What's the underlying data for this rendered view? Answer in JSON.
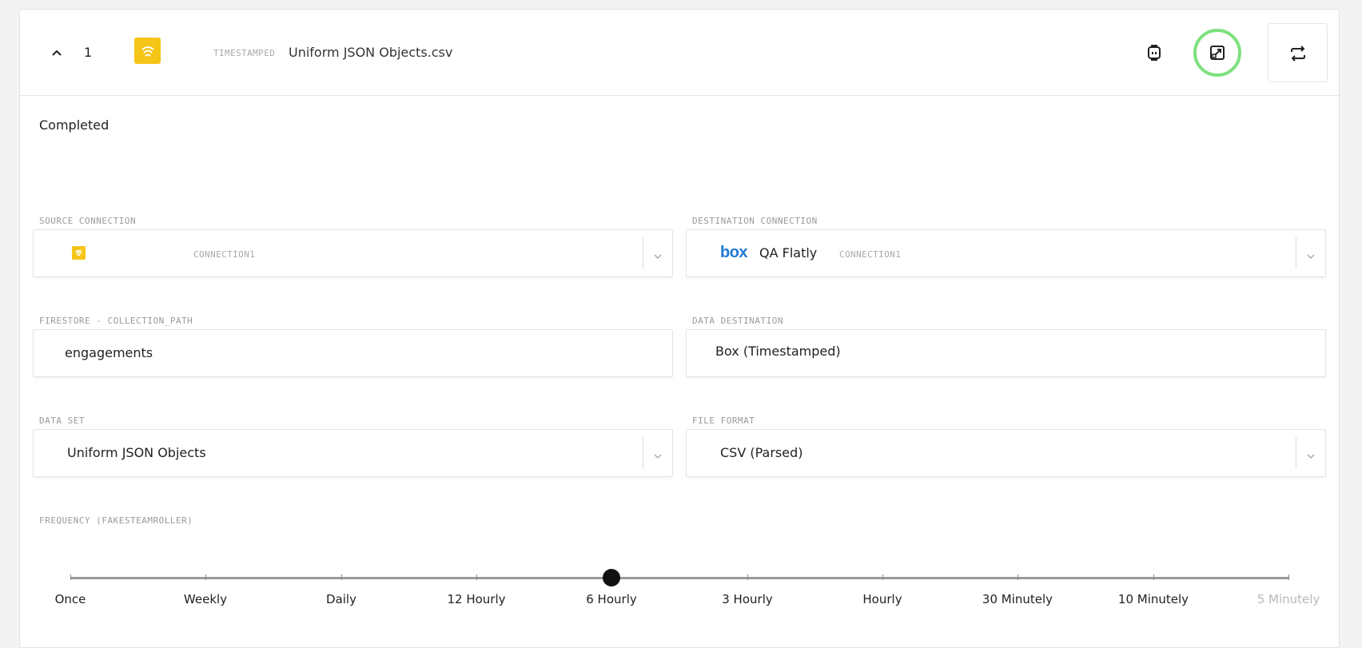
{
  "header": {
    "row_number": "1",
    "tag": "TIMESTAMPED",
    "file_name": "Uniform JSON Objects.csv"
  },
  "status": "Completed",
  "source_connection": {
    "label": "SOURCE CONNECTION",
    "tag": "CONNECTION1",
    "icon": "firestore-logo-icon"
  },
  "destination_connection": {
    "label": "DESTINATION CONNECTION",
    "logo_text": "box",
    "name": "QA Flatly",
    "tag": "CONNECTION1"
  },
  "collection_path": {
    "label": "FIRESTORE - COLLECTION_PATH",
    "value": "engagements"
  },
  "data_destination": {
    "label": "DATA DESTINATION",
    "value": "Box (Timestamped)"
  },
  "data_set": {
    "label": "DATA SET",
    "value": "Uniform JSON Objects"
  },
  "file_format": {
    "label": "FILE FORMAT",
    "value": "CSV (Parsed)"
  },
  "frequency": {
    "label": "FREQUENCY (FAKESTEAMROLLER)",
    "options": [
      "Once",
      "Weekly",
      "Daily",
      "12 Hourly",
      "6 Hourly",
      "3 Hourly",
      "Hourly",
      "30 Minutely",
      "10 Minutely",
      "5 Minutely"
    ],
    "selected": "6 Hourly",
    "disabled": [
      "5 Minutely"
    ]
  },
  "colors": {
    "accent_yellow": "#f5c518",
    "box_blue": "#1e78d6",
    "highlight_ring": "#7ee07e"
  }
}
